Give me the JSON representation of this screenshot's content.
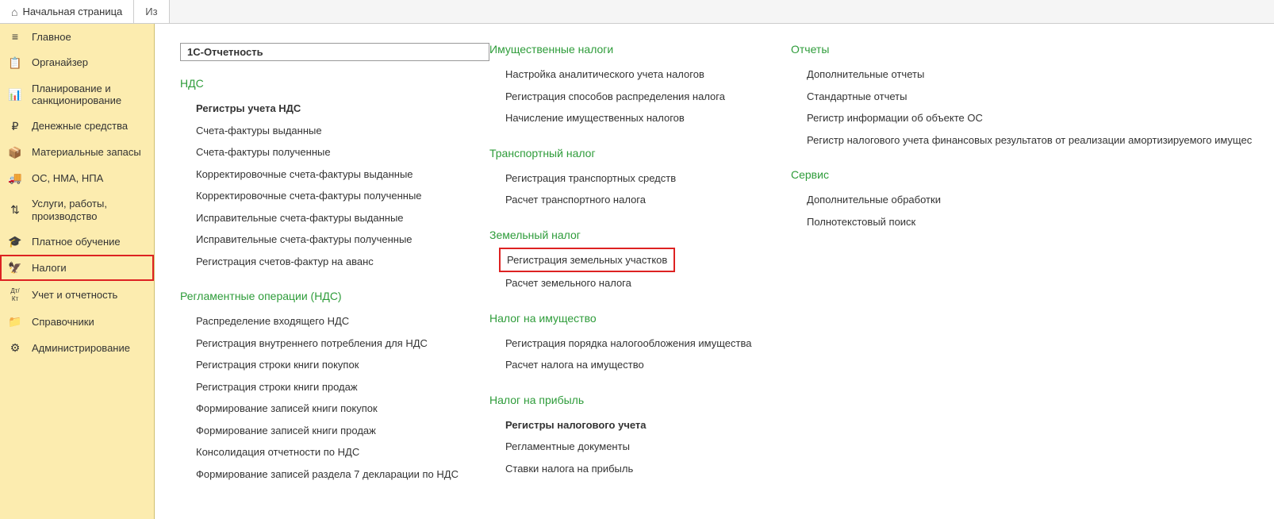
{
  "tabs": {
    "home": "Начальная страница",
    "partial": "Из"
  },
  "sidebar": [
    {
      "icon": "≡",
      "label": "Главное"
    },
    {
      "icon": "📋",
      "label": "Органайзер"
    },
    {
      "icon": "📊",
      "label": "Планирование и санкционирование"
    },
    {
      "icon": "₽",
      "label": "Денежные средства"
    },
    {
      "icon": "📦",
      "label": "Материальные запасы"
    },
    {
      "icon": "🚚",
      "label": "ОС, НМА, НПА"
    },
    {
      "icon": "⇅",
      "label": "Услуги, работы, производство"
    },
    {
      "icon": "🎓",
      "label": "Платное обучение"
    },
    {
      "icon": "🦅",
      "label": "Налоги"
    },
    {
      "icon": "Дт/Кт",
      "label": "Учет и отчетность"
    },
    {
      "icon": "📁",
      "label": "Справочники"
    },
    {
      "icon": "⚙",
      "label": "Администрирование"
    }
  ],
  "col1": {
    "boxed": "1С-Отчетность",
    "g1": {
      "h": "НДС",
      "items": [
        "Регистры учета НДС",
        "Счета-фактуры выданные",
        "Счета-фактуры полученные",
        "Корректировочные счета-фактуры выданные",
        "Корректировочные счета-фактуры полученные",
        "Исправительные счета-фактуры выданные",
        "Исправительные счета-фактуры полученные",
        "Регистрация счетов-фактур на аванс"
      ]
    },
    "g2": {
      "h": "Регламентные операции (НДС)",
      "items": [
        "Распределение входящего НДС",
        "Регистрация внутреннего потребления для НДС",
        "Регистрация строки книги покупок",
        "Регистрация строки книги продаж",
        "Формирование записей книги покупок",
        "Формирование записей книги продаж",
        "Консолидация отчетности по НДС",
        "Формирование записей раздела 7 декларации по НДС"
      ]
    }
  },
  "col2": {
    "g1": {
      "h": "Имущественные налоги",
      "items": [
        "Настройка аналитического учета налогов",
        "Регистрация способов распределения налога",
        "Начисление имущественных налогов"
      ]
    },
    "g2": {
      "h": "Транспортный налог",
      "items": [
        "Регистрация транспортных средств",
        "Расчет транспортного налога"
      ]
    },
    "g3": {
      "h": "Земельный налог",
      "items": [
        "Регистрация земельных участков",
        "Расчет земельного налога"
      ]
    },
    "g4": {
      "h": "Налог на имущество",
      "items": [
        "Регистрация порядка налогообложения имущества",
        "Расчет налога на имущество"
      ]
    },
    "g5": {
      "h": "Налог на прибыль",
      "items": [
        "Регистры налогового учета",
        "Регламентные документы",
        "Ставки налога на прибыль"
      ]
    }
  },
  "col3": {
    "g1": {
      "h": "Отчеты",
      "items": [
        "Дополнительные отчеты",
        "Стандартные отчеты",
        "Регистр информации об объекте ОС",
        "Регистр налогового учета финансовых результатов от реализации амортизируемого имущес"
      ]
    },
    "g2": {
      "h": "Сервис",
      "items": [
        "Дополнительные обработки",
        "Полнотекстовый поиск"
      ]
    }
  }
}
